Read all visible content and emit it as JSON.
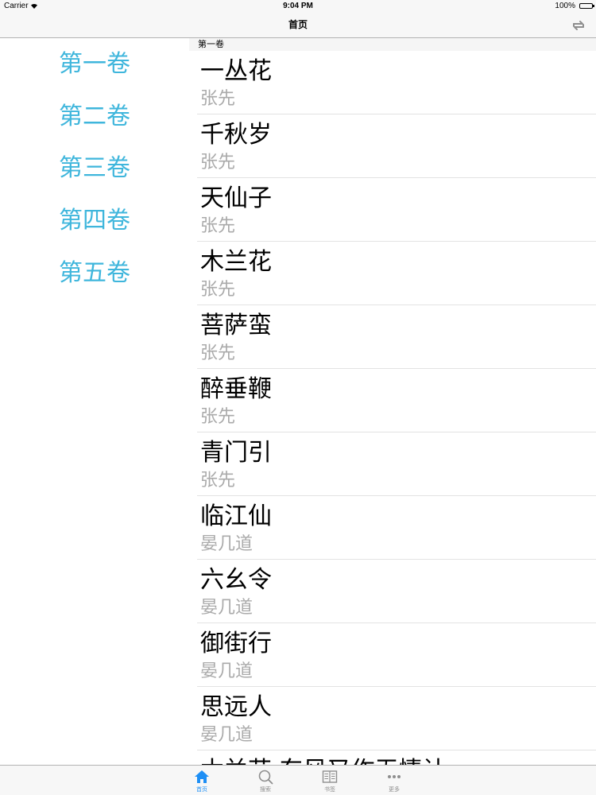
{
  "status_bar": {
    "carrier": "Carrier",
    "time": "9:04 PM",
    "battery": "100%"
  },
  "nav": {
    "title": "首页",
    "refresh_icon": "refresh-icon"
  },
  "sidebar": {
    "items": [
      {
        "label": "第一卷"
      },
      {
        "label": "第二卷"
      },
      {
        "label": "第三卷"
      },
      {
        "label": "第四卷"
      },
      {
        "label": "第五卷"
      }
    ],
    "color": "#3fb6dc"
  },
  "list": {
    "section_title": "第一卷",
    "rows": [
      {
        "title": "一丛花",
        "author": "张先"
      },
      {
        "title": "千秋岁",
        "author": "张先"
      },
      {
        "title": "天仙子",
        "author": "张先"
      },
      {
        "title": "木兰花",
        "author": "张先"
      },
      {
        "title": "菩萨蛮",
        "author": "张先"
      },
      {
        "title": "醉垂鞭",
        "author": "张先"
      },
      {
        "title": "青门引",
        "author": "张先"
      },
      {
        "title": "临江仙",
        "author": "晏几道"
      },
      {
        "title": "六幺令",
        "author": "晏几道"
      },
      {
        "title": "御街行",
        "author": "晏几道"
      },
      {
        "title": "思远人",
        "author": "晏几道"
      },
      {
        "title": "木兰花·东风又作无情计",
        "author": ""
      }
    ]
  },
  "tabbar": {
    "tabs": [
      {
        "label": "首页",
        "icon": "home-icon"
      },
      {
        "label": "搜索",
        "icon": "search-icon"
      },
      {
        "label": "书签",
        "icon": "bookmark-icon"
      },
      {
        "label": "更多",
        "icon": "more-icon"
      }
    ],
    "active_color": "#1e8ff5",
    "inactive_color": "#8e8e8e"
  }
}
